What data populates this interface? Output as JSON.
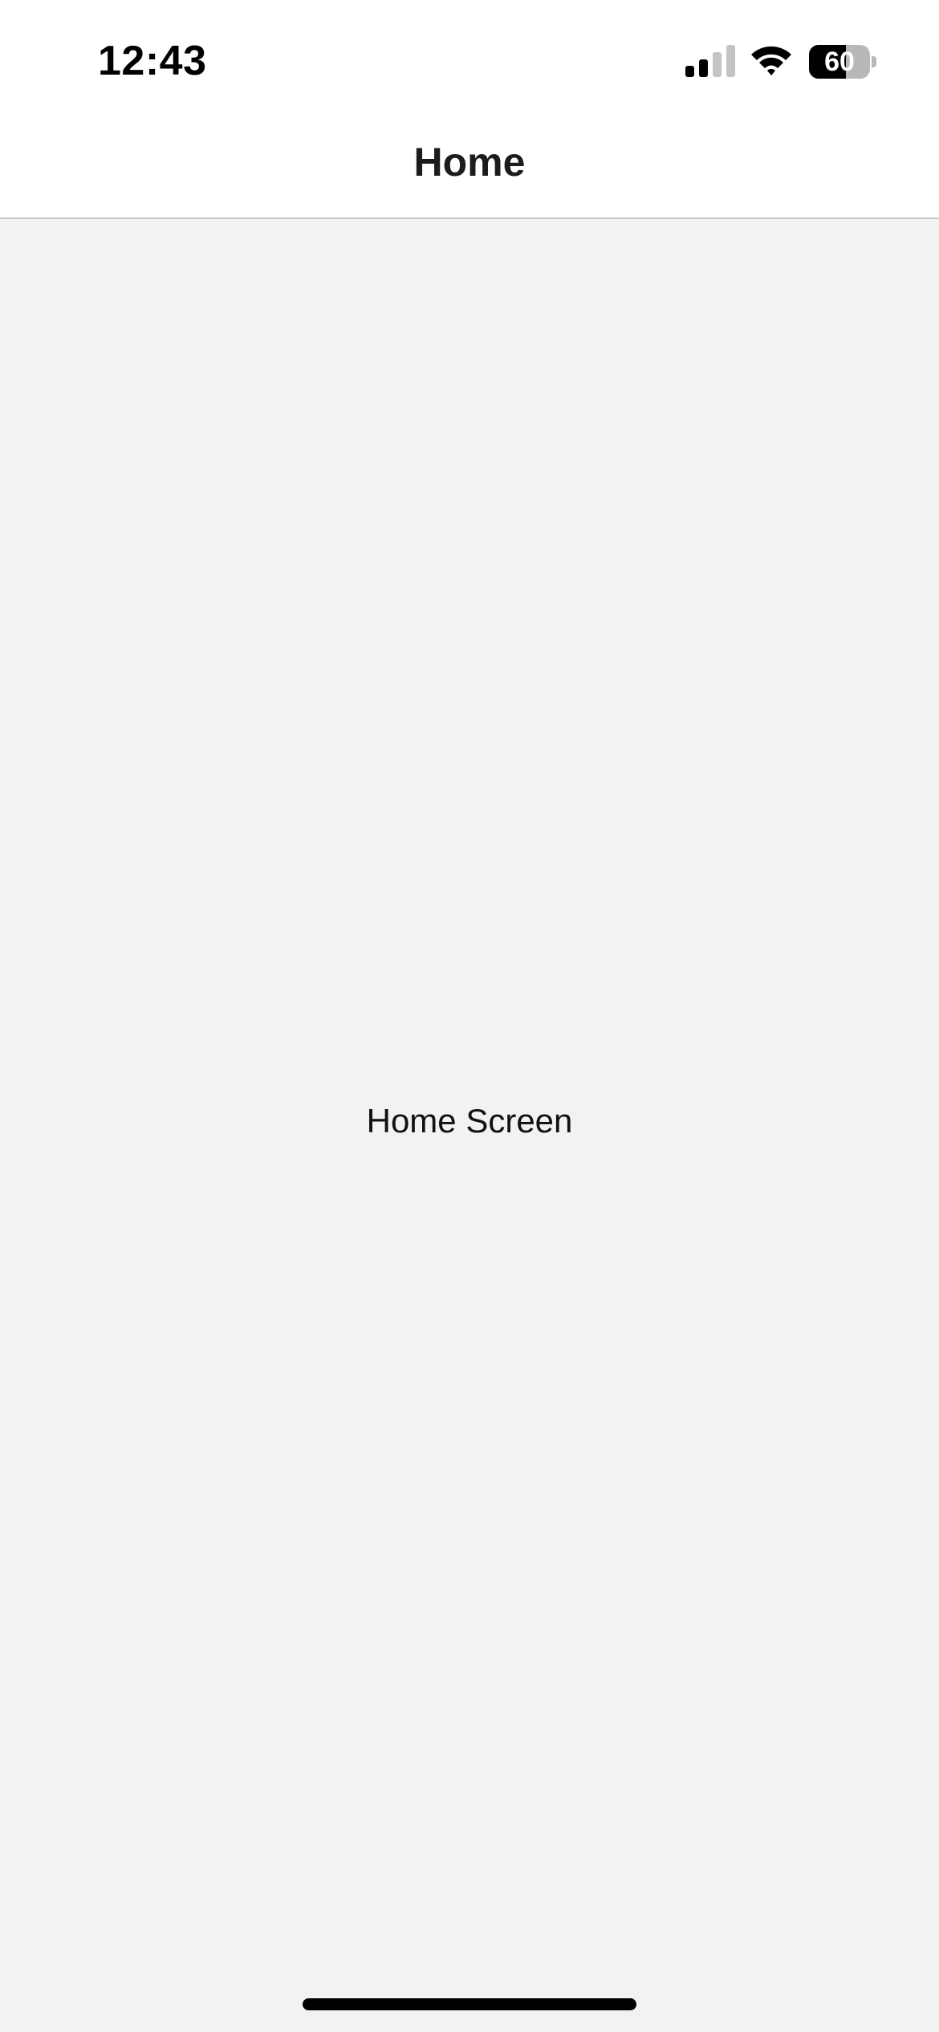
{
  "status_bar": {
    "time": "12:43",
    "signal_icon": "cellular-signal-icon",
    "signal_bars_active": 2,
    "signal_bars_total": 4,
    "wifi_icon": "wifi-icon",
    "battery_percent": "60",
    "battery_level": 0.6
  },
  "nav_bar": {
    "title": "Home"
  },
  "main": {
    "label": "Home Screen"
  },
  "colors": {
    "background": "#f2f2f2",
    "bar_background": "#ffffff",
    "text": "#000000"
  }
}
